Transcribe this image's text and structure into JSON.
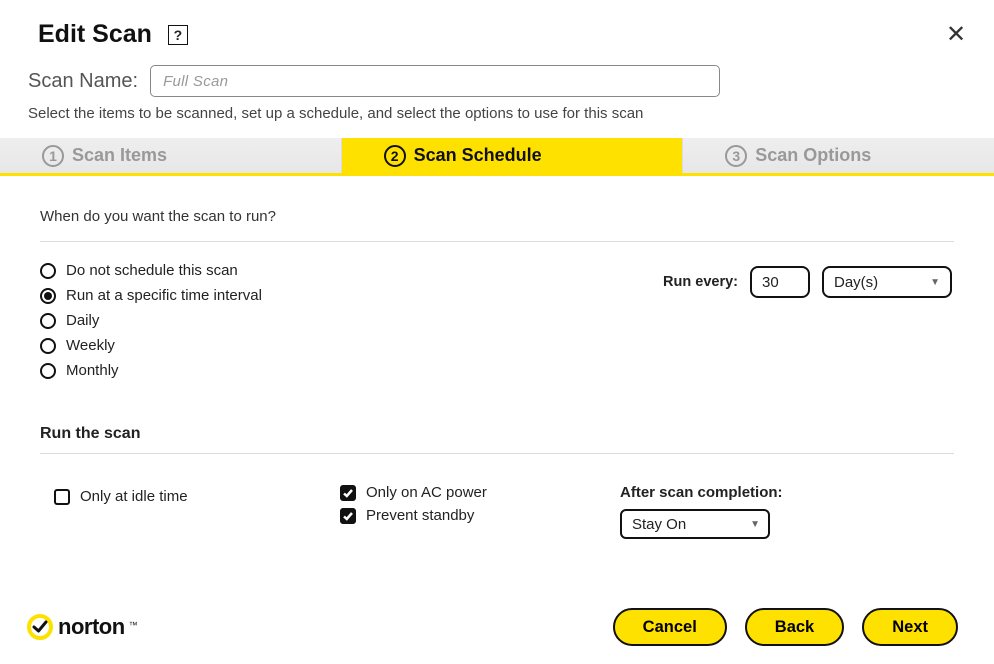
{
  "header": {
    "title": "Edit Scan",
    "help_char": "?",
    "close_char": "✕"
  },
  "scan_name": {
    "label": "Scan Name:",
    "placeholder": "Full Scan",
    "value": ""
  },
  "description": "Select the items to be scanned, set up a schedule, and select the options to use for this scan",
  "tabs": [
    {
      "num": "1",
      "label": "Scan Items"
    },
    {
      "num": "2",
      "label": "Scan Schedule"
    },
    {
      "num": "3",
      "label": "Scan Options"
    }
  ],
  "active_tab_index": 1,
  "schedule": {
    "prompt": "When do you want the scan to run?",
    "options": [
      "Do not schedule this scan",
      "Run at a specific time interval",
      "Daily",
      "Weekly",
      "Monthly"
    ],
    "selected_index": 1,
    "run_every": {
      "label": "Run every:",
      "value": "30",
      "unit": "Day(s)"
    }
  },
  "run_scan": {
    "title": "Run the scan",
    "idle": {
      "label": "Only at idle time",
      "checked": false
    },
    "ac": {
      "label": "Only on AC power",
      "checked": true
    },
    "standby": {
      "label": "Prevent standby",
      "checked": true
    },
    "after": {
      "label": "After scan completion:",
      "value": "Stay On"
    }
  },
  "branding": {
    "name": "norton"
  },
  "footer": {
    "cancel": "Cancel",
    "back": "Back",
    "next": "Next"
  }
}
